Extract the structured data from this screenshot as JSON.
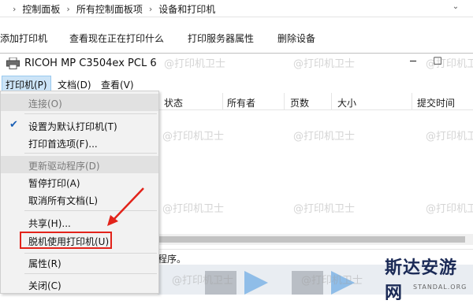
{
  "explorer": {
    "breadcrumb": [
      "控制面板",
      "所有控制面板项",
      "设备和打印机"
    ],
    "commands": [
      "添加打印机",
      "查看现在正在打印什么",
      "打印服务器属性",
      "删除设备"
    ]
  },
  "queue_window": {
    "title": "RICOH MP C3504ex PCL 6",
    "menus": [
      "打印机(P)",
      "文档(D)",
      "查看(V)"
    ],
    "columns": [
      "状态",
      "所有者",
      "页数",
      "大小",
      "提交时间"
    ],
    "status_text": "程序。"
  },
  "printer_menu": {
    "items": [
      {
        "label": "连接(O)",
        "enabled": false,
        "checked": false
      },
      {
        "label": "设置为默认打印机(T)",
        "enabled": true,
        "checked": true
      },
      {
        "label": "打印首选项(F)...",
        "enabled": true,
        "checked": false
      },
      {
        "label": "更新驱动程序(D)",
        "enabled": false,
        "checked": false
      },
      {
        "label": "暂停打印(A)",
        "enabled": true,
        "checked": false
      },
      {
        "label": "取消所有文档(L)",
        "enabled": true,
        "checked": false
      },
      {
        "label": "共享(H)...",
        "enabled": true,
        "checked": false
      },
      {
        "label": "脱机使用打印机(U)",
        "enabled": true,
        "checked": false,
        "highlighted": true
      },
      {
        "label": "属性(R)",
        "enabled": true,
        "checked": false
      },
      {
        "label": "关闭(C)",
        "enabled": true,
        "checked": false
      }
    ]
  },
  "watermark": "@打印机卫士",
  "logo": {
    "text": "斯达安游网",
    "subtext": "STANDAL.ORG"
  },
  "colors": {
    "highlight_box": "#e2231a",
    "arrow": "#e2231a",
    "menu_selected": "#cce4f7",
    "logo": "#1b2a56"
  }
}
